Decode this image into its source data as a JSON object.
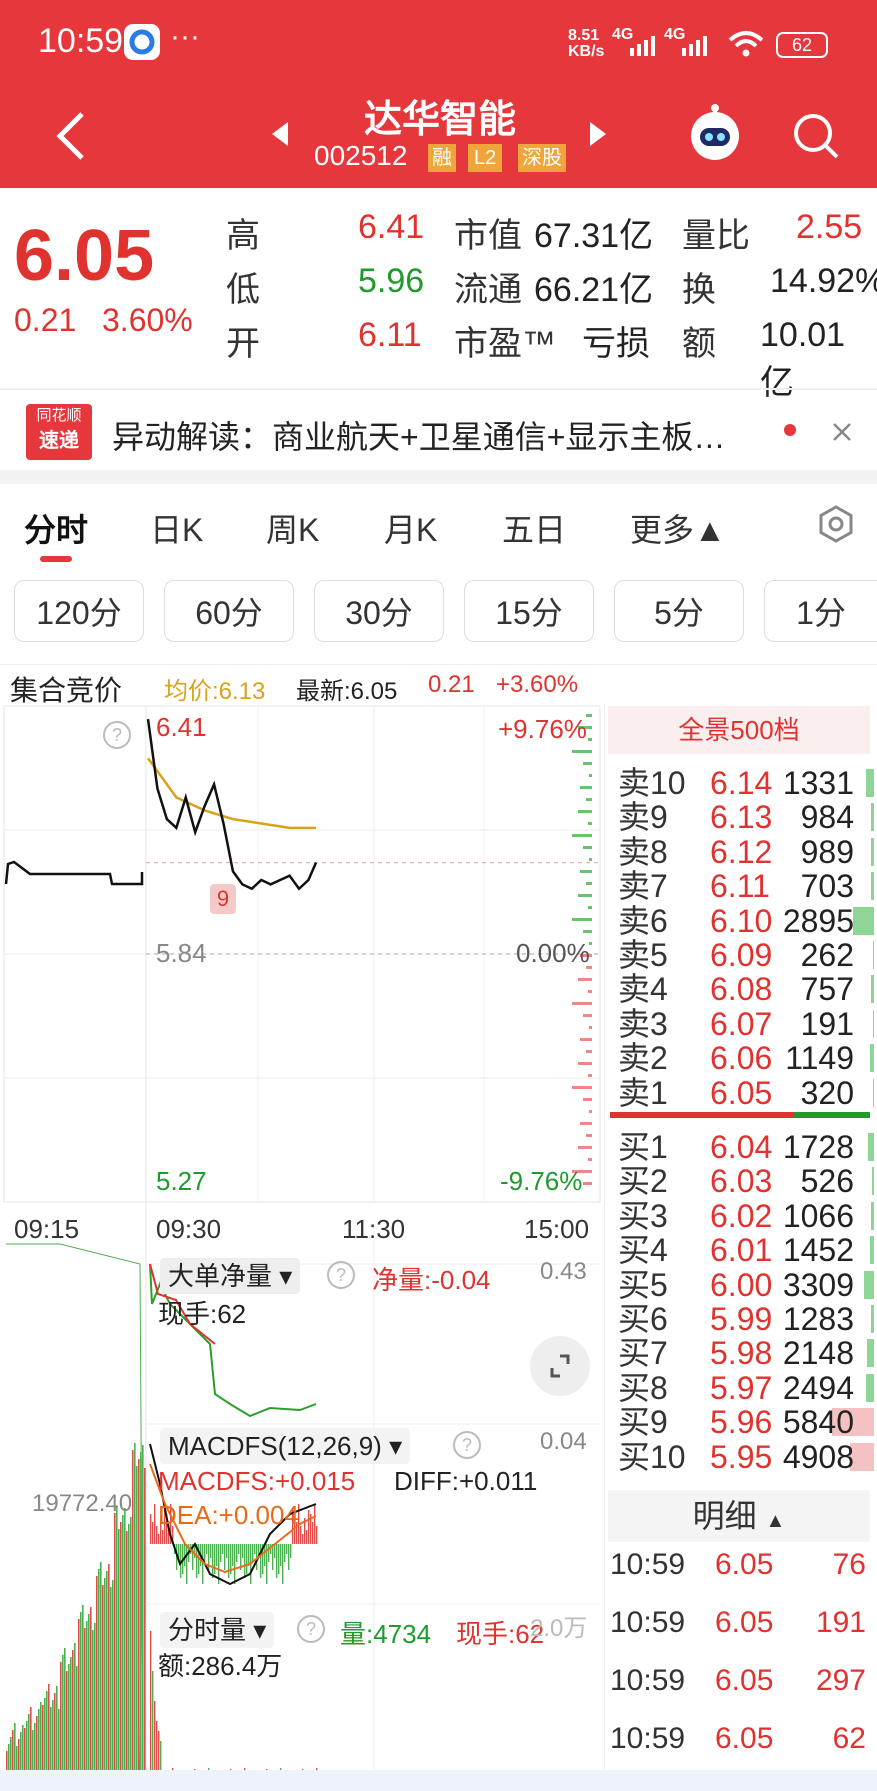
{
  "status": {
    "time": "10:59",
    "dots": "···",
    "speed_top": "8.51",
    "speed_unit": "KB/s",
    "net1": "4G",
    "net2": "4G",
    "battery": "62"
  },
  "header": {
    "title": "达华智能",
    "code": "002512",
    "badges": [
      "融",
      "L2",
      "深股"
    ]
  },
  "quote": {
    "price": "6.05",
    "change": "0.21",
    "change_pct": "3.60%",
    "stats": [
      {
        "label": "高",
        "value": "6.41"
      },
      {
        "label": "低",
        "value": "5.96"
      },
      {
        "label": "开",
        "value": "6.11"
      }
    ],
    "stats2": [
      {
        "label": "市值",
        "value": "67.31亿"
      },
      {
        "label": "流通",
        "value": "66.21亿"
      },
      {
        "label": "市盈™",
        "value": "亏损"
      }
    ],
    "stats3": [
      {
        "label": "量比",
        "value": "2.55"
      },
      {
        "label": "换",
        "value": "14.92%"
      },
      {
        "label": "额",
        "value": "10.01亿"
      }
    ]
  },
  "news": {
    "logo_top": "同花顺",
    "logo_bottom": "速递",
    "text": "异动解读：商业航天+卫星通信+显示主板…"
  },
  "tabs": [
    "分时",
    "日K",
    "周K",
    "月K",
    "五日",
    "更多▲"
  ],
  "periods": [
    "120分",
    "60分",
    "30分",
    "15分",
    "5分",
    "1分"
  ],
  "info_bar": {
    "label": "集合竞价",
    "avg": "均价:6.13",
    "latest": "最新:6.05",
    "chg": "0.21",
    "pct": "+3.60%"
  },
  "chart": {
    "high_label": "6.41",
    "mid_label": "5.84",
    "low_label": "5.27",
    "pct_top": "+9.76%",
    "pct_mid": "0.00%",
    "pct_bottom": "-9.76%",
    "times": [
      "09:15",
      "09:30",
      "11:30",
      "15:00"
    ],
    "marker": "9",
    "auction_label": "19772.40"
  },
  "chart_data": {
    "type": "line",
    "title": "",
    "ylim": [
      5.27,
      6.41
    ],
    "xlabel": "",
    "ylabel": "",
    "series": [
      {
        "name": "",
        "x": [
          "09:30",
          "09:35",
          "09:40",
          "09:45",
          "09:50",
          "09:55",
          "10:00",
          "10:05",
          "10:10",
          "10:15",
          "10:20",
          "10:25",
          "10:30",
          "10:35",
          "10:40",
          "10:45",
          "10:50",
          "10:55",
          "10:59"
        ],
        "values": [
          6.38,
          6.22,
          6.15,
          6.13,
          6.2,
          6.12,
          6.18,
          6.23,
          6.14,
          6.03,
          6.0,
          5.99,
          6.01,
          6.0,
          6.01,
          6.02,
          5.99,
          6.01,
          6.05
        ]
      },
      {
        "name": "",
        "x": [
          "09:30",
          "09:45",
          "10:00",
          "10:15",
          "10:30",
          "10:45",
          "10:59"
        ],
        "values": [
          6.29,
          6.2,
          6.17,
          6.15,
          6.14,
          6.13,
          6.13
        ]
      }
    ]
  },
  "orderbook": {
    "header": "全景500档",
    "sells": [
      {
        "label": "卖10",
        "price": "6.14",
        "vol": "1331",
        "bar": 0.12
      },
      {
        "label": "卖9",
        "price": "6.13",
        "vol": "984",
        "bar": 0.05
      },
      {
        "label": "卖8",
        "price": "6.12",
        "vol": "989",
        "bar": 0.05
      },
      {
        "label": "卖7",
        "price": "6.11",
        "vol": "703",
        "bar": 0.04
      },
      {
        "label": "卖6",
        "price": "6.10",
        "vol": "2895",
        "bar": 0.3
      },
      {
        "label": "卖5",
        "price": "6.09",
        "vol": "262",
        "bar": 0.02
      },
      {
        "label": "卖4",
        "price": "6.08",
        "vol": "757",
        "bar": 0.04
      },
      {
        "label": "卖3",
        "price": "6.07",
        "vol": "191",
        "bar": 0.02
      },
      {
        "label": "卖2",
        "price": "6.06",
        "vol": "1149",
        "bar": 0.06
      },
      {
        "label": "卖1",
        "price": "6.05",
        "vol": "320",
        "bar": 0.02
      }
    ],
    "buys": [
      {
        "label": "买1",
        "price": "6.04",
        "vol": "1728",
        "bar": 0.08
      },
      {
        "label": "买2",
        "price": "6.03",
        "vol": "526",
        "bar": 0.03
      },
      {
        "label": "买3",
        "price": "6.02",
        "vol": "1066",
        "bar": 0.05
      },
      {
        "label": "买4",
        "price": "6.01",
        "vol": "1452",
        "bar": 0.06
      },
      {
        "label": "买5",
        "price": "6.00",
        "vol": "3309",
        "bar": 0.15
      },
      {
        "label": "买6",
        "price": "5.99",
        "vol": "1283",
        "bar": 0.05
      },
      {
        "label": "买7",
        "price": "5.98",
        "vol": "2148",
        "bar": 0.1
      },
      {
        "label": "买8",
        "price": "5.97",
        "vol": "2494",
        "bar": 0.12
      },
      {
        "label": "买9",
        "price": "5.96",
        "vol": "5840",
        "bar": 0.6
      },
      {
        "label": "买10",
        "price": "5.95",
        "vol": "4908",
        "bar": 0.35
      }
    ]
  },
  "detail": {
    "header": "明细",
    "rows": [
      {
        "time": "10:59",
        "price": "6.05",
        "vol": "76"
      },
      {
        "time": "10:59",
        "price": "6.05",
        "vol": "191"
      },
      {
        "time": "10:59",
        "price": "6.05",
        "vol": "297"
      },
      {
        "time": "10:59",
        "price": "6.05",
        "vol": "62"
      }
    ]
  },
  "indicators": {
    "p1": {
      "name": "大单净量",
      "net": "净量:-0.04",
      "max": "0.43",
      "hand": "现手:62"
    },
    "p2": {
      "name": "MACDFS(12,26,9)",
      "max": "0.04",
      "macd": "MACDFS:+0.015",
      "diff": "DIFF:+0.011",
      "dea": "DEA:+0.004"
    },
    "p3": {
      "name": "分时量",
      "vol": "量:4734",
      "hand": "现手:62",
      "max": "2.0万",
      "amount": "额:286.4万"
    }
  },
  "colors": {
    "brand": "#e5373c",
    "up": "#e0332f",
    "down": "#1f9a2c",
    "avg_line": "#d9a21b"
  }
}
